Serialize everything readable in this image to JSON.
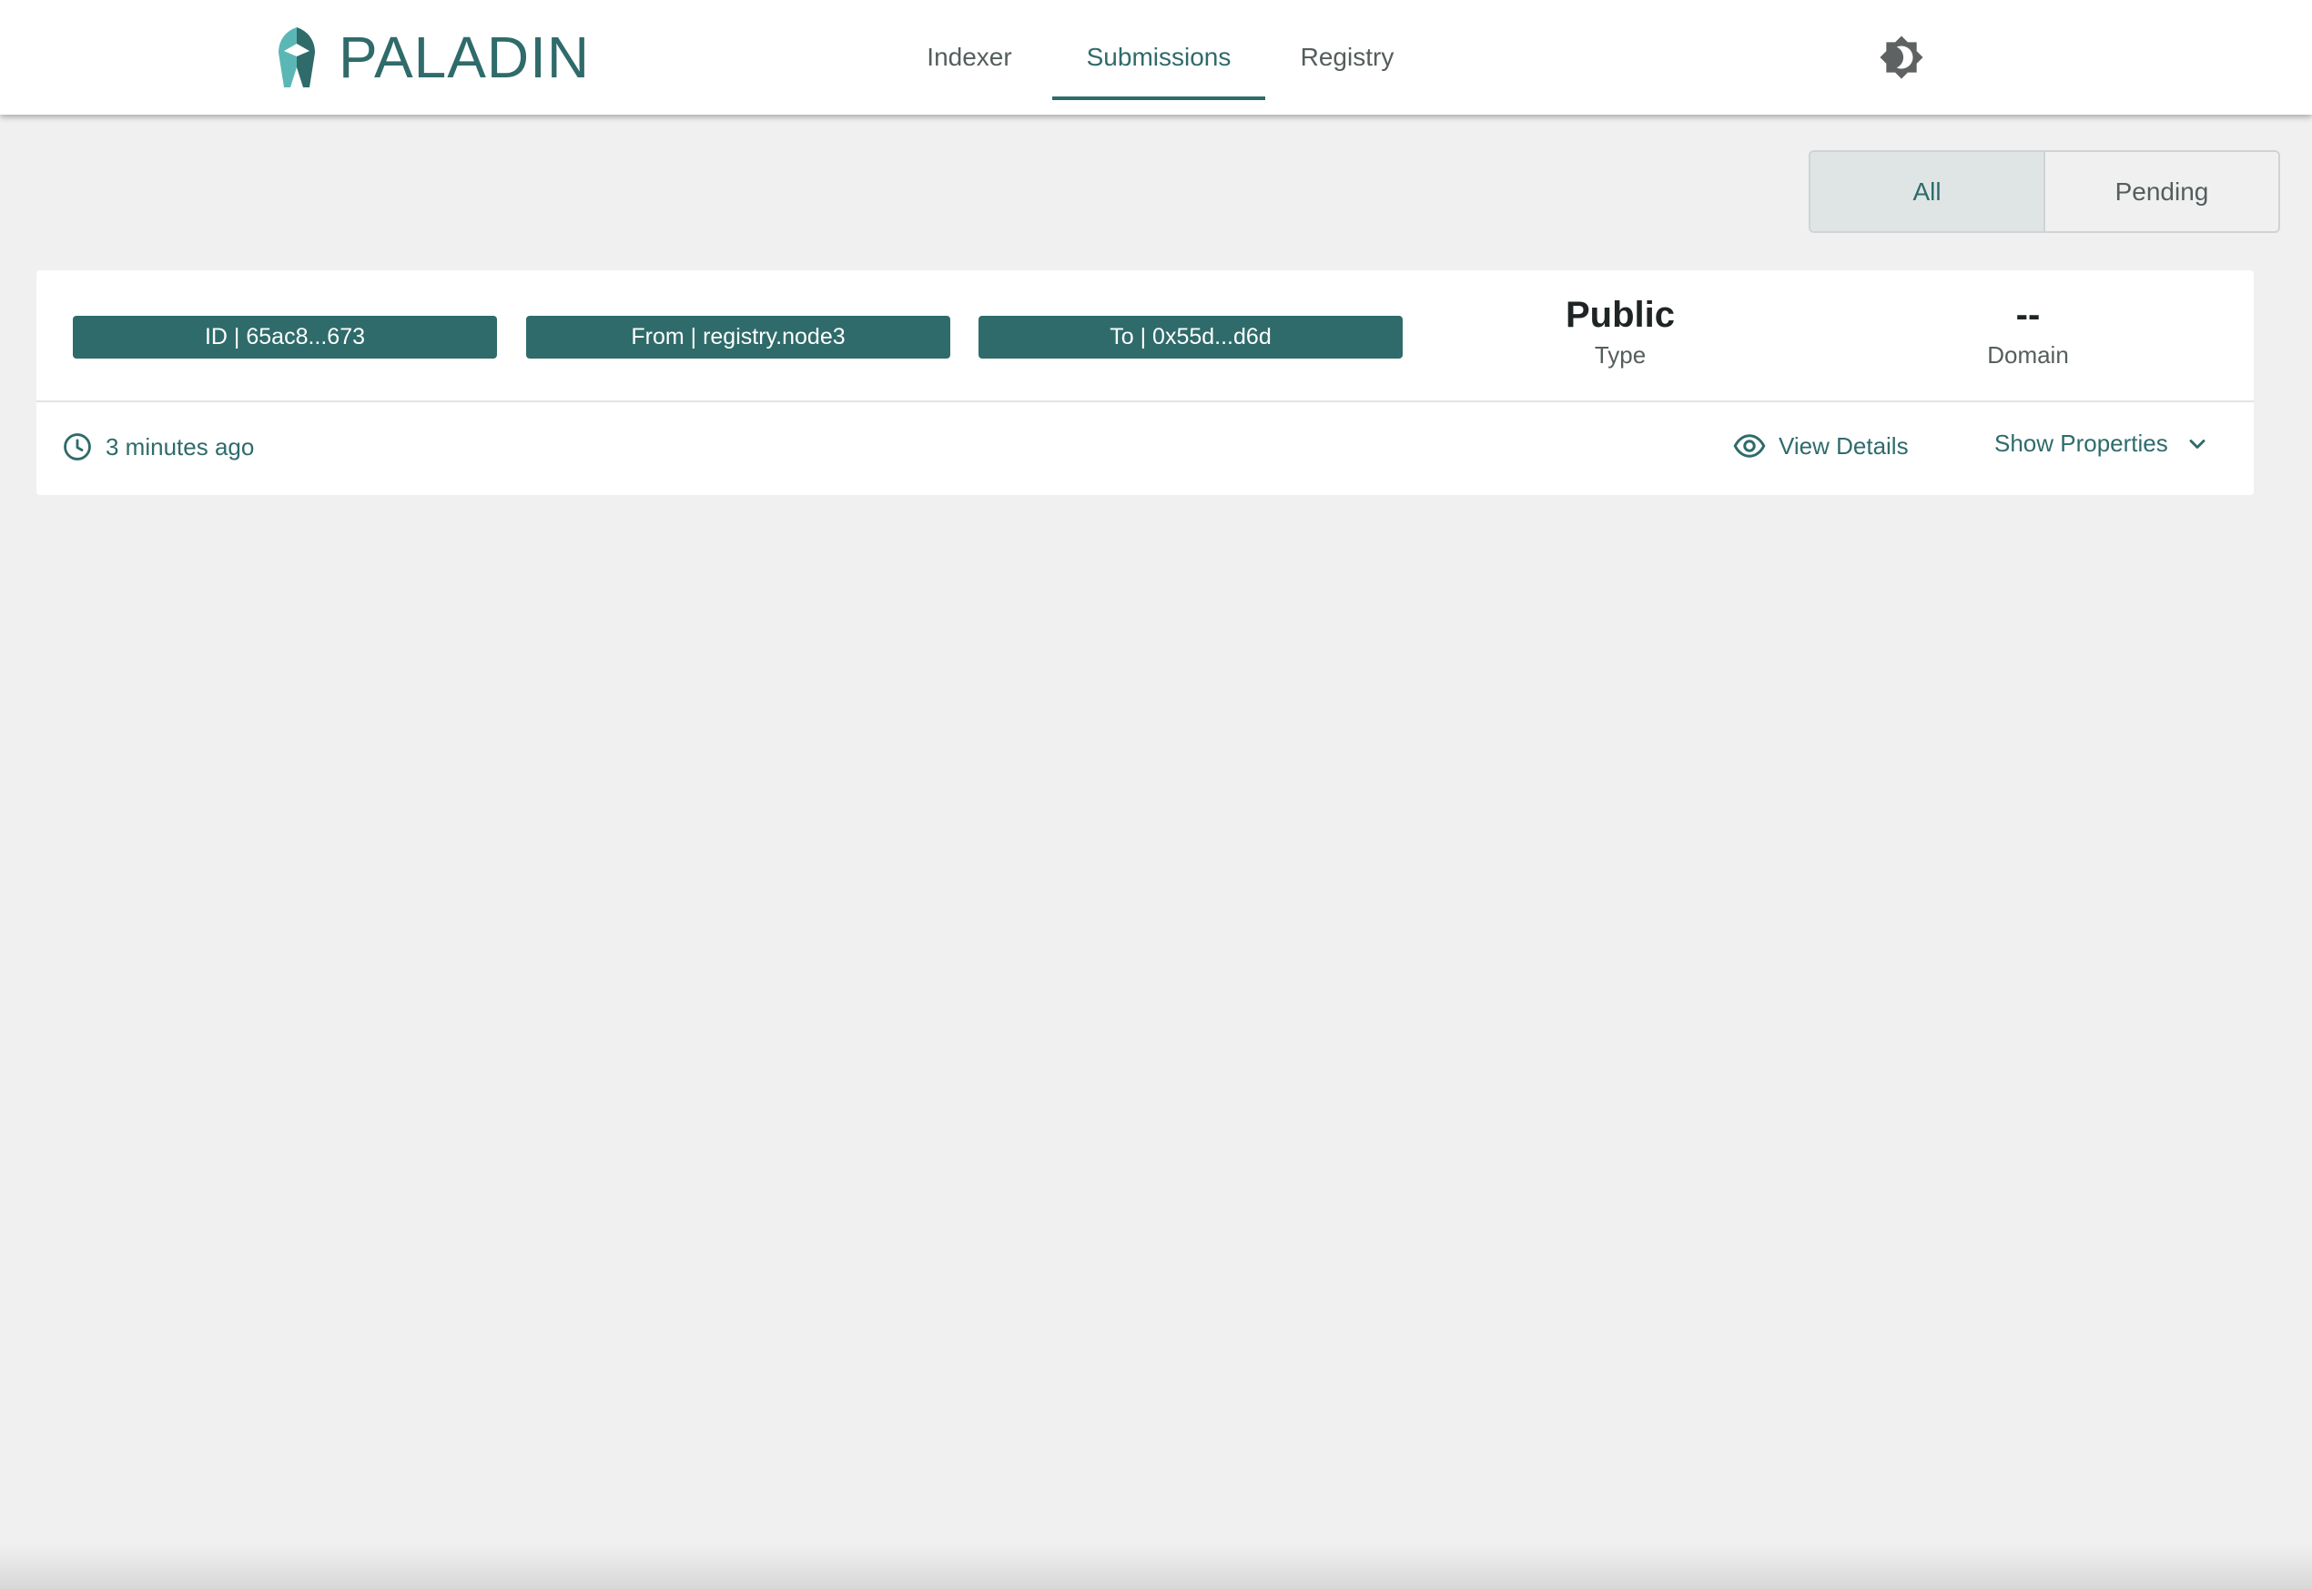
{
  "app": {
    "logo_text": "PALADIN",
    "accent_color": "#2f6b6b"
  },
  "nav": {
    "tabs": [
      {
        "label": "Indexer",
        "active": false
      },
      {
        "label": "Submissions",
        "active": true
      },
      {
        "label": "Registry",
        "active": false
      }
    ],
    "theme_toggle_icon": "brightness-icon"
  },
  "filters": {
    "options": [
      {
        "label": "All",
        "selected": true
      },
      {
        "label": "Pending",
        "selected": false
      }
    ]
  },
  "submissions": [
    {
      "id_chip": "ID | 65ac8...673",
      "from_chip": "From | registry.node3",
      "to_chip": "To | 0x55d...d6d",
      "type_value": "Public",
      "type_label": "Type",
      "domain_value": "--",
      "domain_label": "Domain",
      "time": "3 minutes ago",
      "view_details_label": "View Details",
      "show_properties_label": "Show Properties"
    }
  ]
}
